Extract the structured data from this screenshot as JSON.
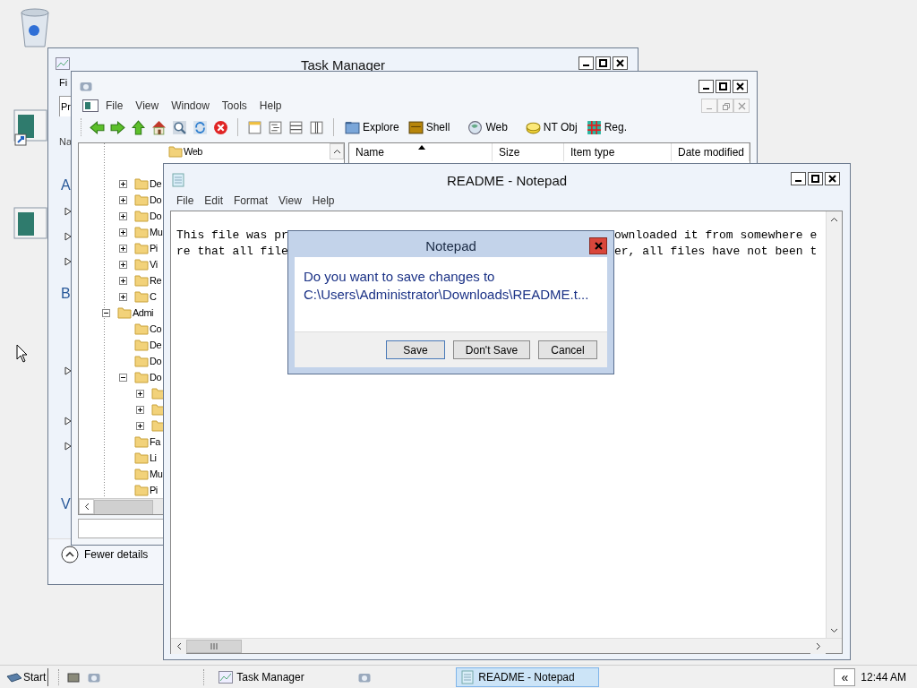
{
  "task_manager": {
    "title": "Task Manager",
    "menu": [
      "Fi"
    ],
    "tabs": [
      {
        "label": "Pr",
        "selected": true
      }
    ],
    "column": "Na",
    "rows": [
      {
        "kind": "group",
        "label": "A"
      },
      {
        "kind": "process",
        "expanded": false
      },
      {
        "kind": "process",
        "expanded": false
      },
      {
        "kind": "process",
        "expanded": false
      },
      {
        "kind": "group",
        "label": "B"
      },
      {
        "kind": "process",
        "expanded": false
      },
      {
        "kind": "process",
        "expanded": false
      },
      {
        "kind": "process",
        "expanded": false
      },
      {
        "kind": "group",
        "label": "V"
      }
    ],
    "footer": "Fewer details"
  },
  "explorer": {
    "menu": [
      "File",
      "View",
      "Window",
      "Tools",
      "Help"
    ],
    "toolbar": [
      {
        "label": "Explore"
      },
      {
        "label": "Shell"
      },
      {
        "label": "Web"
      },
      {
        "label": "NT Obj"
      },
      {
        "label": "Reg."
      }
    ],
    "tree": [
      {
        "children": [
          {
            "children": [
              {
                "children": [
                  {
                    "label": "Web"
                  }
                ]
              }
            ]
          },
          {
            "label": "De",
            "expanded": false
          },
          {
            "label": "Do",
            "expanded": false
          },
          {
            "label": "Do",
            "expanded": false
          },
          {
            "label": "Mu",
            "expanded": false
          },
          {
            "label": "Pi",
            "expanded": false
          },
          {
            "label": "Vi",
            "expanded": false
          },
          {
            "label": "Re",
            "expanded": false
          },
          {
            "label": "C",
            "expanded": false
          }
        ]
      },
      {
        "label": "Admi",
        "expanded": true,
        "children": [
          {
            "label": "Co"
          },
          {
            "label": "De"
          },
          {
            "label": "Do"
          },
          {
            "label": "Do",
            "expanded": true,
            "children": [
              {
                "expanded": false
              },
              {
                "expanded": false
              },
              {
                "expanded": false
              }
            ]
          },
          {
            "label": "Fa"
          },
          {
            "label": "Li"
          },
          {
            "label": "Mu"
          },
          {
            "label": "Pi"
          }
        ]
      }
    ],
    "columns": [
      {
        "label": "Name",
        "sorted": true
      },
      {
        "label": "Size",
        "sorted": false
      },
      {
        "label": "Item type",
        "sorted": false
      },
      {
        "label": "Date modified",
        "sorted": false
      }
    ]
  },
  "notepad": {
    "title": "README - Notepad",
    "menu": [
      "File",
      "Edit",
      "Format",
      "View",
      "Help"
    ],
    "lines": [
      {
        "left": "This file was pr",
        "right": "ownloaded it from somewhere e"
      },
      {
        "left": "re that all file",
        "right": "er, all files have not been t"
      }
    ]
  },
  "dialog": {
    "title": "Notepad",
    "message": "Do you want to save changes to C:\\Users\\Administrator\\Downloads\\README.t...",
    "buttons": [
      "Save",
      "Don't Save",
      "Cancel"
    ]
  },
  "taskbar": {
    "start": "Start",
    "buttons": [
      {
        "label": "Task Manager",
        "selected": false
      },
      {
        "label": "README - Notepad",
        "selected": true
      }
    ],
    "tray": "«",
    "clock": "12:44 AM"
  }
}
